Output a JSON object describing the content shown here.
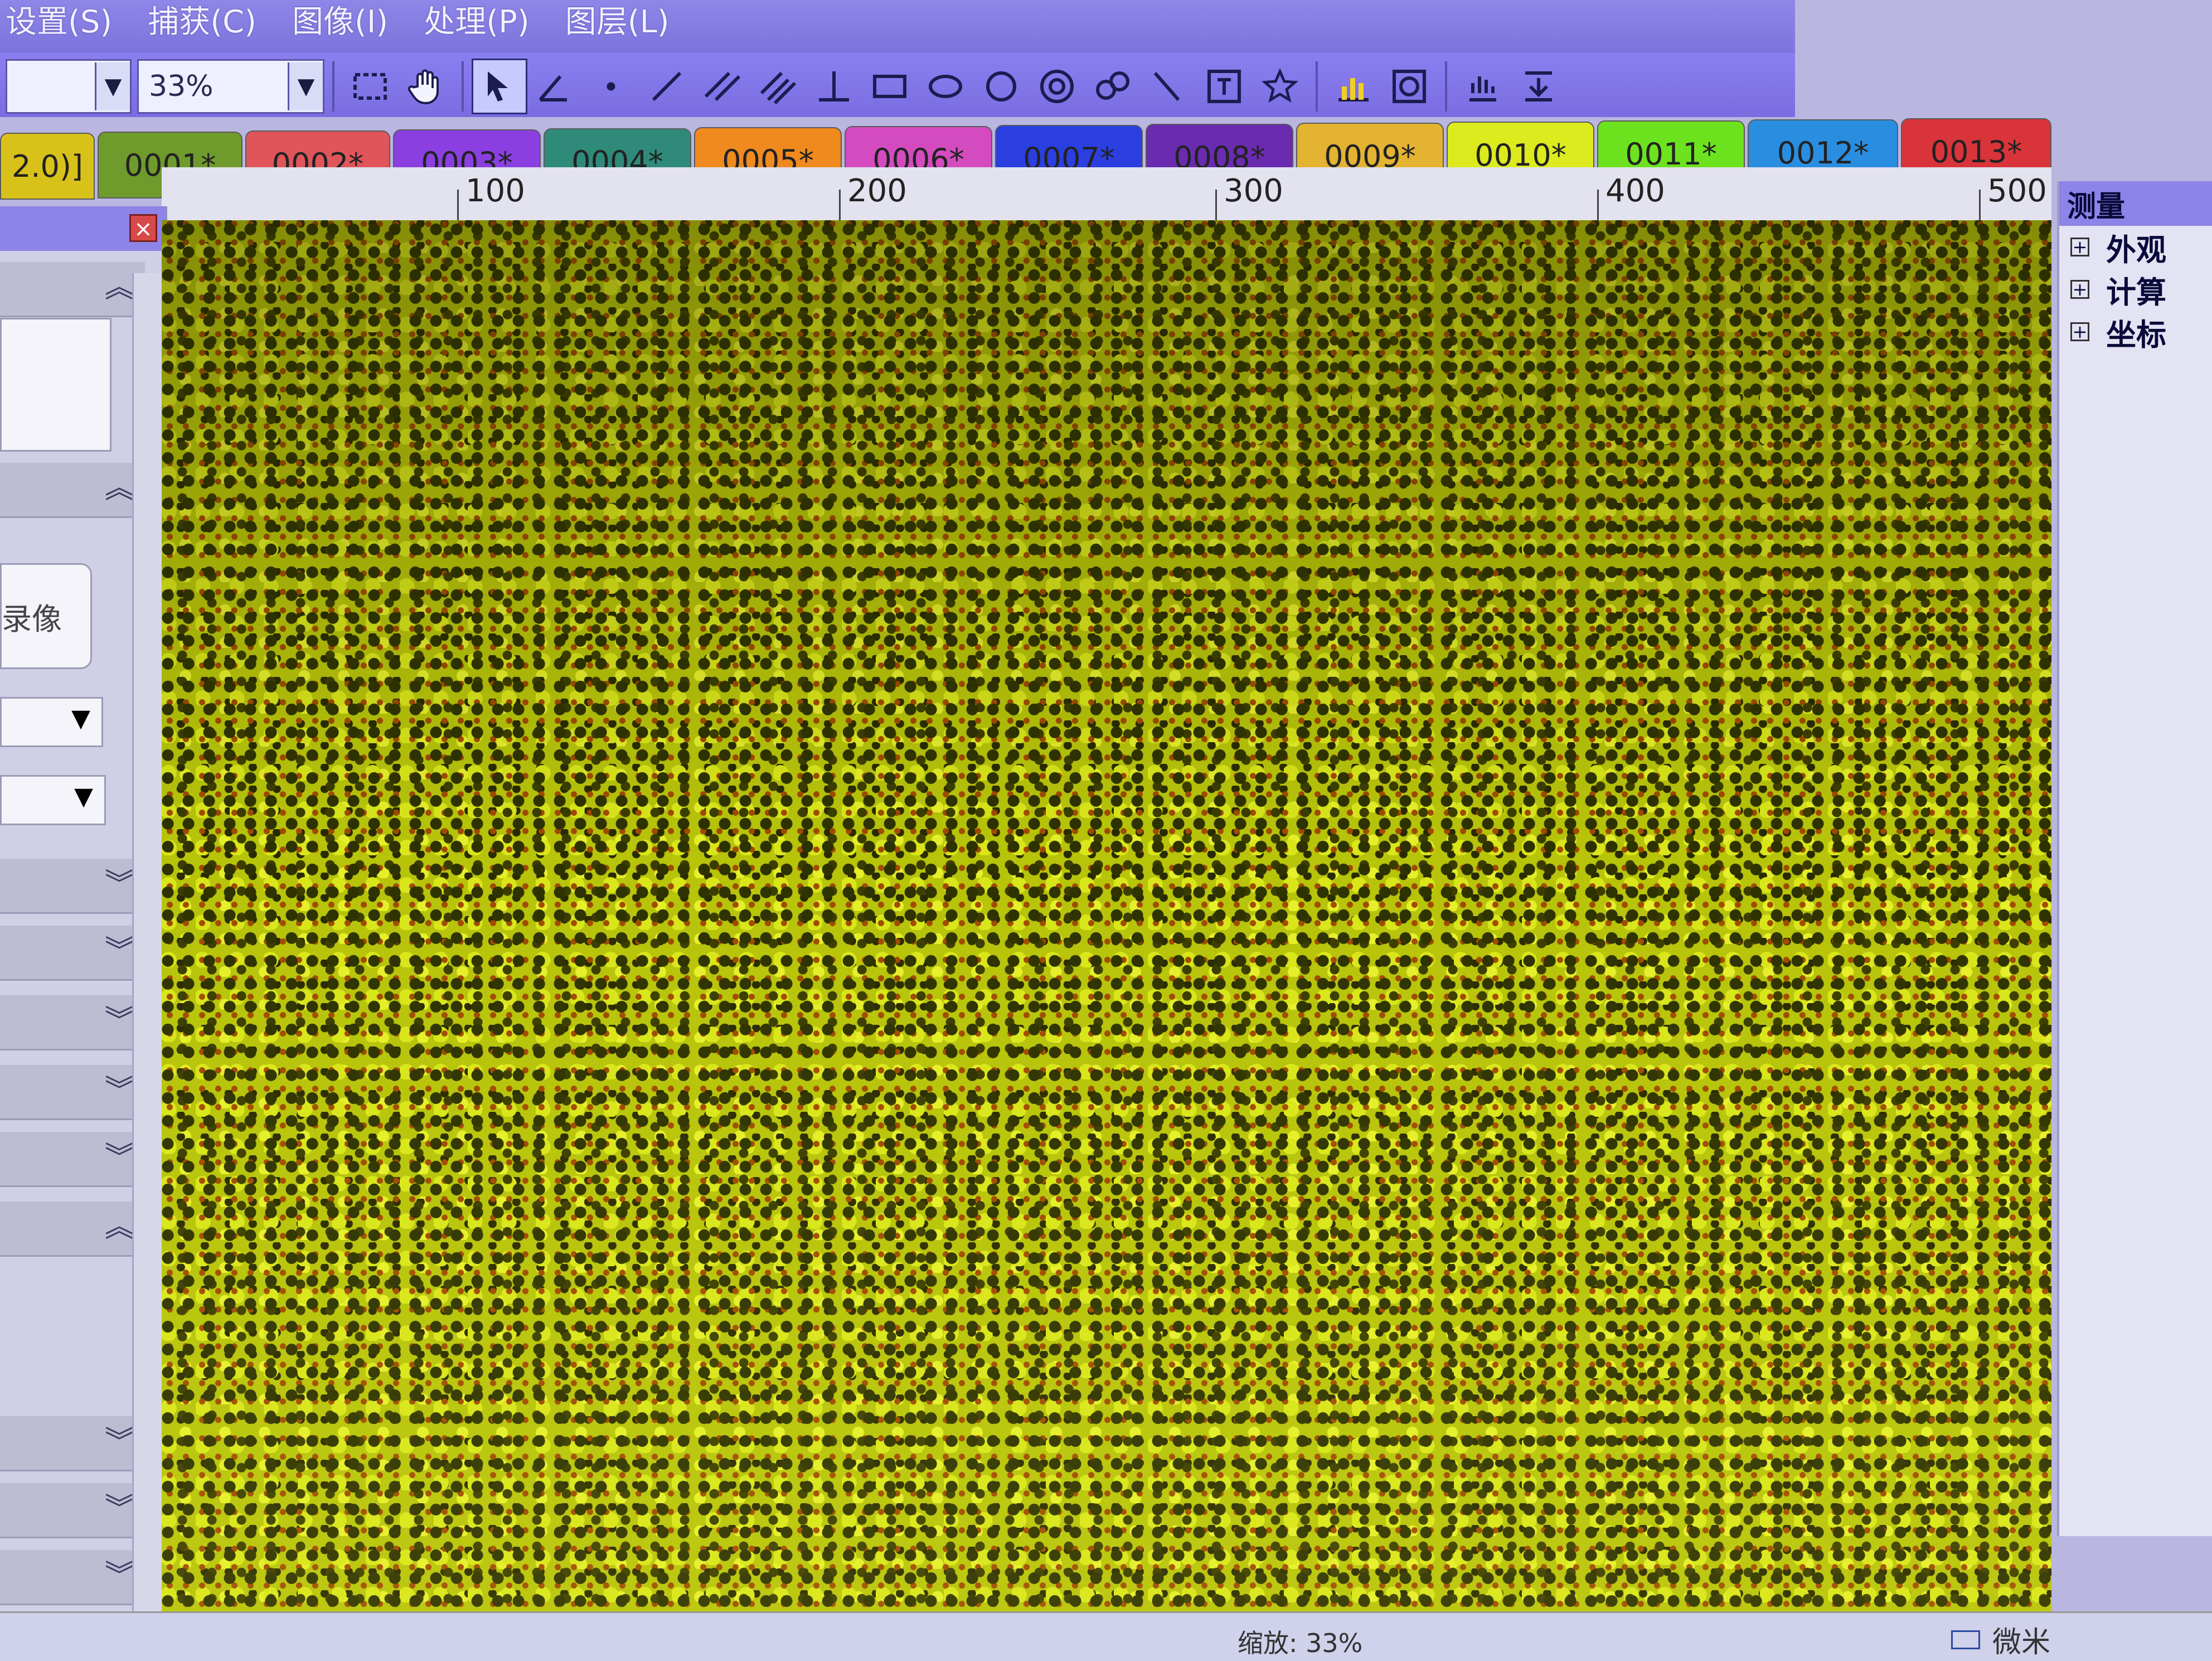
{
  "menu": [
    {
      "label": "设置(S)"
    },
    {
      "label": "捕获(C)"
    },
    {
      "label": "图像(I)"
    },
    {
      "label": "处理(P)"
    },
    {
      "label": "图层(L)"
    }
  ],
  "toolbar": {
    "zoom_value": "33%",
    "tools": [
      "rect-select-icon",
      "hand-icon",
      "pointer-icon",
      "angle-icon",
      "point-icon",
      "line-icon",
      "parallel-line-icon",
      "multi-line-icon",
      "perpendicular-icon",
      "rectangle-icon",
      "ellipse-icon",
      "circle-icon",
      "concentric-circle-icon",
      "polygon-icon",
      "polyline-icon",
      "text-icon",
      "star-icon",
      "chart-icon",
      "capture-icon",
      "settings-icon",
      "export-icon"
    ]
  },
  "tabs": [
    {
      "label": "2.0)]",
      "color": "#d8c21a"
    },
    {
      "label": "0001*",
      "color": "#6f9a2c"
    },
    {
      "label": "0002*",
      "color": "#e0555a"
    },
    {
      "label": "0003*",
      "color": "#8b3fe0"
    },
    {
      "label": "0004*",
      "color": "#2f8a7a"
    },
    {
      "label": "0005*",
      "color": "#f08a1e"
    },
    {
      "label": "0006*",
      "color": "#d44bc0"
    },
    {
      "label": "0007*",
      "color": "#2b3fe0"
    },
    {
      "label": "0008*",
      "color": "#6a2bb0"
    },
    {
      "label": "0009*",
      "color": "#e3b331"
    },
    {
      "label": "0010*",
      "color": "#dcea1e"
    },
    {
      "label": "0011*",
      "color": "#6de21e"
    },
    {
      "label": "0012*",
      "color": "#2a8ee0"
    },
    {
      "label": "0013*",
      "color": "#d8343a"
    }
  ],
  "ruler": {
    "labels": [
      "100",
      "200",
      "300",
      "400",
      "500"
    ]
  },
  "left_panel": {
    "button_text": "录像"
  },
  "right_panel": {
    "title": "测量",
    "items": [
      {
        "label": "外观"
      },
      {
        "label": "计算"
      },
      {
        "label": "坐标"
      }
    ]
  },
  "status": {
    "zoom": "缩放: 33%",
    "unit": "微米"
  },
  "colors": {
    "accent": "#8e83e8",
    "image_yellow": "#c8d20c",
    "image_dark": "#2e3200"
  }
}
